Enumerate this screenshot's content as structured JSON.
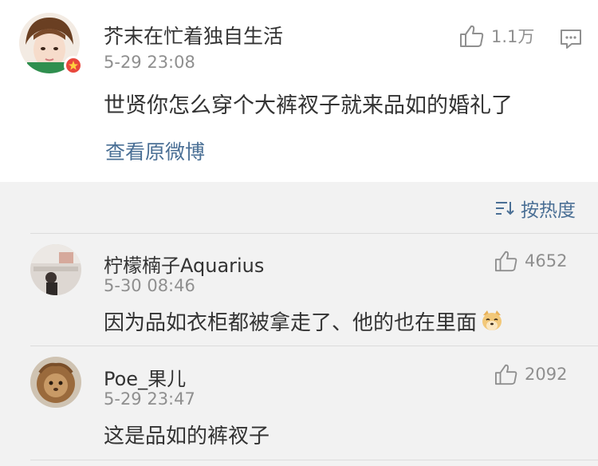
{
  "main_post": {
    "username": "芥末在忙着独自生活",
    "time": "5-29 23:08",
    "content": "世贤你怎么穿个大裤衩子就来品如的婚礼了",
    "likes": "1.1万",
    "view_original": "查看原微博"
  },
  "sort": {
    "label": "按热度"
  },
  "replies": [
    {
      "username": "柠檬楠子Aquarius",
      "time": "5-30 08:46",
      "content": "因为品如衣柜都被拿走了、他的也在里面",
      "likes": "4652"
    },
    {
      "username": "Poe_果儿",
      "time": "5-29 23:47",
      "content": "这是品如的裤衩子",
      "likes": "2092"
    }
  ],
  "colors": {
    "link": "#4a6f95",
    "text": "#333333",
    "meta": "#8f8f8f",
    "verify": "#e8473c"
  }
}
